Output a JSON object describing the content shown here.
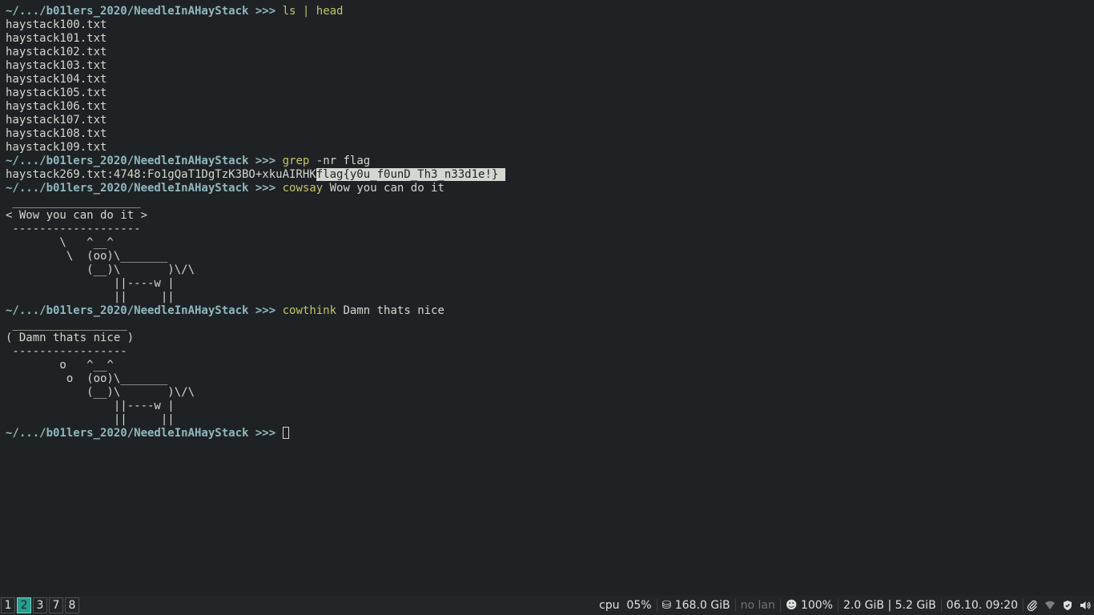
{
  "terminal": {
    "prompt_path": "~/.../b01lers_2020/NeedleInAHayStack",
    "prompt_arrows": ">>>",
    "cmd1": {
      "command": "ls",
      "args": "| head"
    },
    "ls_output": [
      "haystack100.txt",
      "haystack101.txt",
      "haystack102.txt",
      "haystack103.txt",
      "haystack104.txt",
      "haystack105.txt",
      "haystack106.txt",
      "haystack107.txt",
      "haystack108.txt",
      "haystack109.txt"
    ],
    "cmd2": {
      "command": "grep",
      "args": "-nr flag"
    },
    "grep_prefix": "haystack269.txt:4748:Fo1gQaT1DgTzK3BO+xkuAIRHK",
    "grep_match": "flag{y0u_f0unD_Th3_n33d1e!} ",
    "cmd3": {
      "command": "cowsay",
      "args": "Wow you can do it"
    },
    "cowsay_output": [
      " ___________________",
      "< Wow you can do it >",
      " -------------------",
      "        \\   ^__^",
      "         \\  (oo)\\_______",
      "            (__)\\       )\\/\\",
      "                ||----w |",
      "                ||     ||"
    ],
    "cmd4": {
      "command": "cowthink",
      "args": "Damn thats nice"
    },
    "cowthink_output": [
      " _________________",
      "( Damn thats nice )",
      " -----------------",
      "        o   ^__^",
      "         o  (oo)\\_______",
      "            (__)\\       )\\/\\",
      "                ||----w |",
      "                ||     ||"
    ]
  },
  "statusbar": {
    "workspaces": [
      "1",
      "2",
      "3",
      "7",
      "8"
    ],
    "active_workspace": "2",
    "cpu_label": "cpu",
    "cpu_value": "05%",
    "disk": "168.0 GiB",
    "lan": "no lan",
    "battery": "100%",
    "memory": "2.0 GiB | 5.2 GiB",
    "datetime": "06.10. 09:20"
  },
  "colors": {
    "background": "#1f2224",
    "prompt": "#8fb8bf",
    "command": "#c4c36a",
    "text": "#d3d7cf",
    "active_workspace": "#2a9d8f"
  }
}
